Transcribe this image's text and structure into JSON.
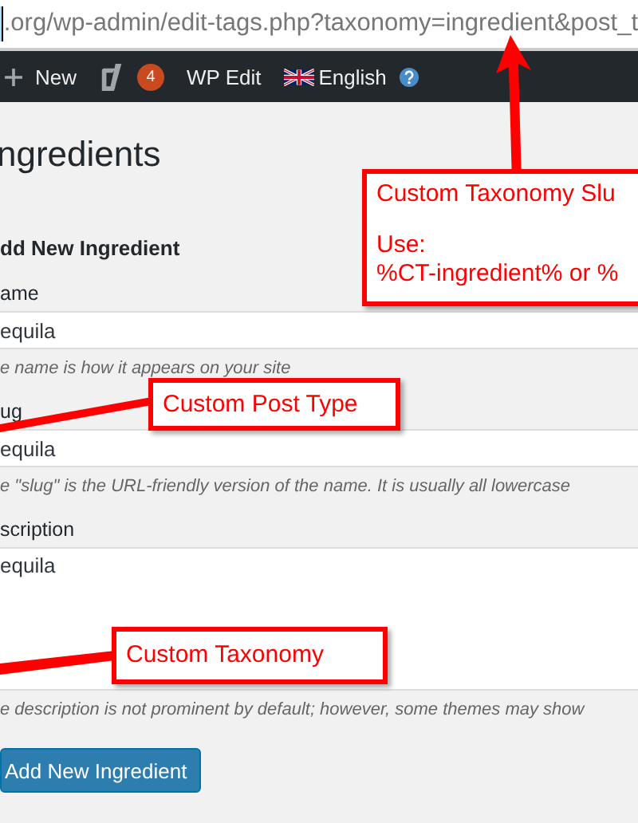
{
  "address_bar": {
    "url": ".org/wp-admin/edit-tags.php?taxonomy=ingredient&post_t"
  },
  "admin_bar": {
    "items": [
      {
        "kind": "new",
        "label": "New"
      },
      {
        "kind": "yoast",
        "badge": "4"
      },
      {
        "kind": "text",
        "label": "WP Edit"
      },
      {
        "kind": "language",
        "label": "English"
      }
    ]
  },
  "page": {
    "title": "ngredients",
    "form_title": "dd New Ingredient",
    "fields": [
      {
        "kind": "input",
        "label": "ame",
        "value": "equila",
        "hint": "e name is how it appears on your site"
      },
      {
        "kind": "input",
        "label": "ug",
        "value": "equila",
        "hint": "e \"slug\" is the URL-friendly version of the name. It is usually all lowercase"
      },
      {
        "kind": "textarea",
        "label": "scription",
        "value": "equila",
        "hint": "e description is not prominent by default; however, some themes may show"
      }
    ],
    "submit": "Add New Ingredient"
  },
  "annotations": [
    {
      "heading": "Custom Taxonomy Slu",
      "lines": [
        "Use:",
        "%CT-ingredient% or %"
      ]
    },
    {
      "heading": "Custom Post Type"
    },
    {
      "heading": "Custom Taxonomy"
    }
  ]
}
